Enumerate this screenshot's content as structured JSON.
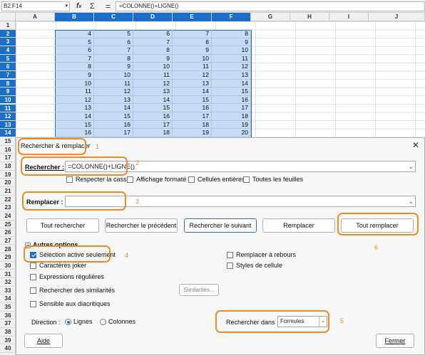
{
  "formula_bar": {
    "cell_ref": "B2:F14",
    "fx": "f",
    "sum": "Σ",
    "equals": "=",
    "formula": "=COLONNE()+LIGNE()"
  },
  "columns": [
    "A",
    "B",
    "C",
    "D",
    "E",
    "F",
    "G",
    "H",
    "I",
    "J"
  ],
  "rows": [
    "1",
    "2",
    "3",
    "4",
    "5",
    "6",
    "7",
    "8",
    "9",
    "10",
    "11",
    "12",
    "13",
    "14",
    "15",
    "16",
    "17",
    "18",
    "19",
    "20",
    "21",
    "22",
    "23",
    "24",
    "25",
    "26",
    "27",
    "28",
    "29",
    "30",
    "31",
    "32",
    "33",
    "34",
    "35",
    "36",
    "37",
    "38",
    "39",
    "40"
  ],
  "cell_values": [
    [
      "4",
      "5",
      "6",
      "7",
      "8"
    ],
    [
      "5",
      "6",
      "7",
      "8",
      "9"
    ],
    [
      "6",
      "7",
      "8",
      "9",
      "10"
    ],
    [
      "7",
      "8",
      "9",
      "10",
      "11"
    ],
    [
      "8",
      "9",
      "10",
      "11",
      "12"
    ],
    [
      "9",
      "10",
      "11",
      "12",
      "13"
    ],
    [
      "10",
      "11",
      "12",
      "13",
      "14"
    ],
    [
      "11",
      "12",
      "13",
      "14",
      "15"
    ],
    [
      "12",
      "13",
      "14",
      "15",
      "16"
    ],
    [
      "13",
      "14",
      "15",
      "16",
      "17"
    ],
    [
      "14",
      "15",
      "16",
      "17",
      "18"
    ],
    [
      "15",
      "16",
      "17",
      "18",
      "19"
    ],
    [
      "16",
      "17",
      "18",
      "19",
      "20"
    ]
  ],
  "dialog": {
    "title": "Rechercher & remplacer",
    "close": "✕",
    "search_label": "Rechercher :",
    "search_value": "=COLONNE()+LIGNE()",
    "match_case": "Respecter la casse",
    "formatted": "Affichage formaté",
    "whole_cells": "Cellules entières",
    "all_sheets": "Toutes les feuilles",
    "replace_label": "Remplacer :",
    "replace_value": "",
    "btn_find_all": "Tout rechercher",
    "btn_find_prev": "Rechercher le précédent",
    "btn_find_next": "Rechercher le suivant",
    "btn_replace": "Remplacer",
    "btn_replace_all": "Tout remplacer",
    "other_options": "Autres options",
    "selection_only": "Sélection active seulement",
    "wildcards": "Caractères joker",
    "regex": "Expressions régulières",
    "similarity": "Rechercher des similarités",
    "similarities_btn": "Similarités...",
    "diacritics": "Sensible aux diacritiques",
    "backwards": "Remplacer à rebours",
    "cell_styles": "Styles de cellule",
    "direction_label": "Direction :",
    "dir_rows": "Lignes",
    "dir_cols": "Colonnes",
    "search_in_label": "Rechercher dans :",
    "search_in_value": "Formules",
    "help": "Aide",
    "close_btn": "Fermer"
  },
  "annotations": {
    "n1": "1",
    "n2": "2",
    "n3": "3",
    "n4": "4",
    "n5": "5",
    "n6": "6"
  },
  "colors": {
    "accent": "#1c6fc8",
    "annotation": "#f08a24",
    "selection": "#c5dcf3"
  }
}
